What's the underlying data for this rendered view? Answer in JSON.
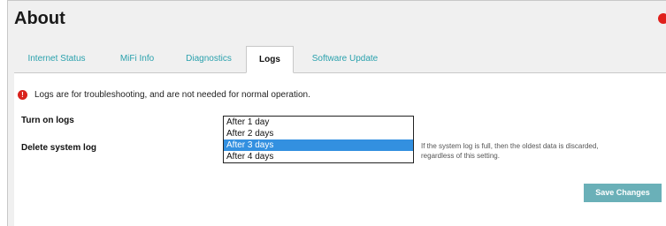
{
  "page": {
    "title": "About"
  },
  "tabs": [
    {
      "label": "Internet Status"
    },
    {
      "label": "MiFi Info"
    },
    {
      "label": "Diagnostics"
    },
    {
      "label": "Logs"
    },
    {
      "label": "Software Update"
    }
  ],
  "active_tab": "Logs",
  "info": {
    "text": "Logs are for troubleshooting, and are not needed for normal operation."
  },
  "settings": {
    "turn_on_logs_label": "Turn on logs",
    "delete_log_label": "Delete system log",
    "dropdown_options": [
      "After 1 day",
      "After 2 days",
      "After 3 days",
      "After 4 days"
    ],
    "selected_option": "After 3 days",
    "hint": "If the system log is full, then the oldest data is discarded, regardless of this setting."
  },
  "actions": {
    "save_label": "Save Changes"
  },
  "colors": {
    "accent": "#2aa1ad",
    "button": "#6ab0b8",
    "alert": "#d9221c",
    "selected": "#3390e0"
  }
}
